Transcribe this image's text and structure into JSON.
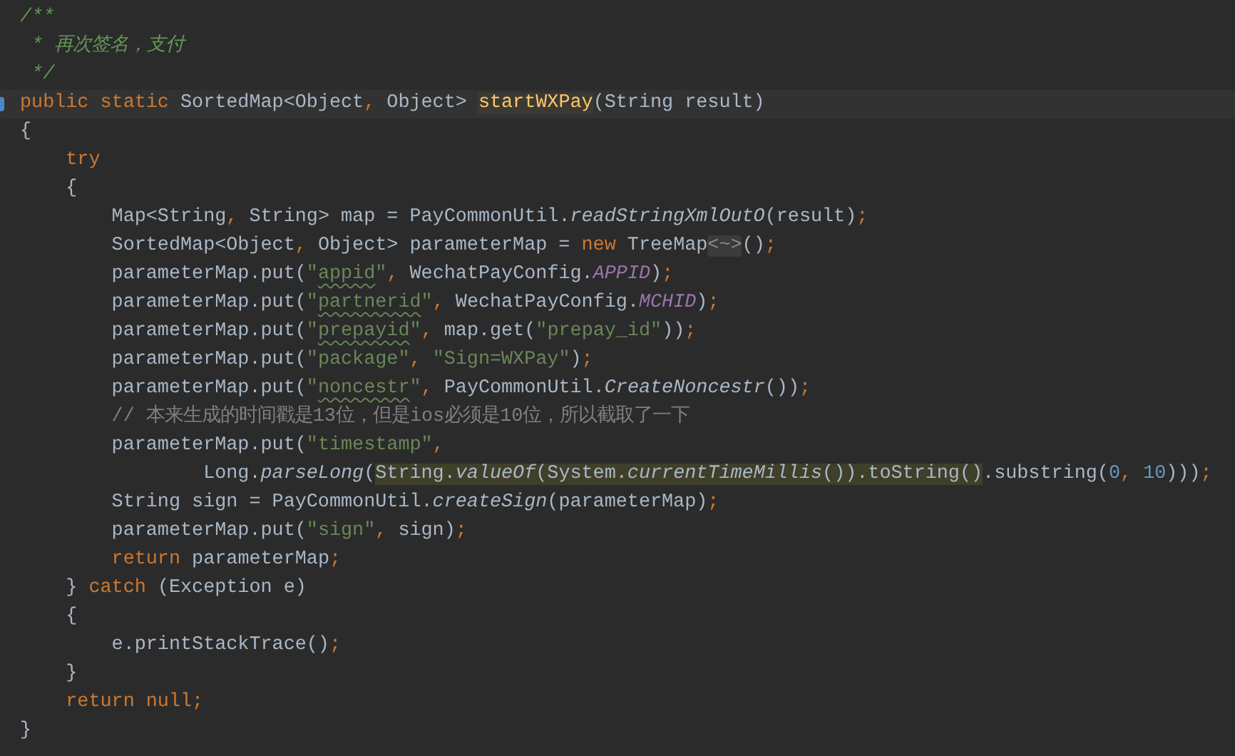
{
  "editor": {
    "lines": [
      {
        "current": false,
        "tokens": [
          {
            "text": "/**",
            "kind": "doc"
          }
        ]
      },
      {
        "current": false,
        "tokens": [
          {
            "text": " * 再次签名，支付",
            "kind": "doc"
          }
        ]
      },
      {
        "current": false,
        "tokens": [
          {
            "text": " */",
            "kind": "doc"
          }
        ]
      },
      {
        "current": true,
        "tokens": [
          {
            "text": "public static ",
            "kind": "keyword"
          },
          {
            "text": "SortedMap<Object",
            "kind": "plain"
          },
          {
            "text": ", ",
            "kind": "punct"
          },
          {
            "text": "Object> ",
            "kind": "plain"
          },
          {
            "text": "startWXPay",
            "kind": "declaration",
            "highlight": true
          },
          {
            "text": "(String result)",
            "kind": "plain"
          }
        ]
      },
      {
        "current": false,
        "tokens": [
          {
            "text": "{",
            "kind": "plain"
          }
        ]
      },
      {
        "current": false,
        "tokens": [
          {
            "text": "    try",
            "kind": "keyword"
          }
        ]
      },
      {
        "current": false,
        "tokens": [
          {
            "text": "    {",
            "kind": "plain"
          }
        ]
      },
      {
        "current": false,
        "tokens": [
          {
            "text": "        Map<String",
            "kind": "plain"
          },
          {
            "text": ", ",
            "kind": "punct"
          },
          {
            "text": "String> map = PayCommonUtil.",
            "kind": "plain"
          },
          {
            "text": "readStringXmlOutO",
            "kind": "call"
          },
          {
            "text": "(result)",
            "kind": "plain"
          },
          {
            "text": ";",
            "kind": "punct"
          }
        ]
      },
      {
        "current": false,
        "tokens": [
          {
            "text": "        SortedMap<Object",
            "kind": "plain"
          },
          {
            "text": ", ",
            "kind": "punct"
          },
          {
            "text": "Object> parameterMap = ",
            "kind": "plain"
          },
          {
            "text": "new ",
            "kind": "keyword"
          },
          {
            "text": "TreeMap",
            "kind": "plain"
          },
          {
            "text": "<~>",
            "kind": "fold"
          },
          {
            "text": "()",
            "kind": "plain"
          },
          {
            "text": ";",
            "kind": "punct"
          }
        ]
      },
      {
        "current": false,
        "tokens": [
          {
            "text": "        parameterMap.put(",
            "kind": "plain"
          },
          {
            "text": "\"",
            "kind": "string"
          },
          {
            "text": "appid",
            "kind": "string",
            "typo": true
          },
          {
            "text": "\"",
            "kind": "string"
          },
          {
            "text": ", ",
            "kind": "punct"
          },
          {
            "text": "WechatPayConfig.",
            "kind": "plain"
          },
          {
            "text": "APPID",
            "kind": "constant"
          },
          {
            "text": ")",
            "kind": "plain"
          },
          {
            "text": ";",
            "kind": "punct"
          }
        ]
      },
      {
        "current": false,
        "tokens": [
          {
            "text": "        parameterMap.put(",
            "kind": "plain"
          },
          {
            "text": "\"",
            "kind": "string"
          },
          {
            "text": "partnerid",
            "kind": "string",
            "typo": true
          },
          {
            "text": "\"",
            "kind": "string"
          },
          {
            "text": ", ",
            "kind": "punct"
          },
          {
            "text": "WechatPayConfig.",
            "kind": "plain"
          },
          {
            "text": "MCHID",
            "kind": "constant"
          },
          {
            "text": ")",
            "kind": "plain"
          },
          {
            "text": ";",
            "kind": "punct"
          }
        ]
      },
      {
        "current": false,
        "tokens": [
          {
            "text": "        parameterMap.put(",
            "kind": "plain"
          },
          {
            "text": "\"",
            "kind": "string"
          },
          {
            "text": "prepayid",
            "kind": "string",
            "typo": true
          },
          {
            "text": "\"",
            "kind": "string"
          },
          {
            "text": ", ",
            "kind": "punct"
          },
          {
            "text": "map.get(",
            "kind": "plain"
          },
          {
            "text": "\"prepay_id\"",
            "kind": "string"
          },
          {
            "text": "))",
            "kind": "plain"
          },
          {
            "text": ";",
            "kind": "punct"
          }
        ]
      },
      {
        "current": false,
        "tokens": [
          {
            "text": "        parameterMap.put(",
            "kind": "plain"
          },
          {
            "text": "\"package\"",
            "kind": "string"
          },
          {
            "text": ", ",
            "kind": "punct"
          },
          {
            "text": "\"Sign=WXPay\"",
            "kind": "string"
          },
          {
            "text": ")",
            "kind": "plain"
          },
          {
            "text": ";",
            "kind": "punct"
          }
        ]
      },
      {
        "current": false,
        "tokens": [
          {
            "text": "        parameterMap.put(",
            "kind": "plain"
          },
          {
            "text": "\"",
            "kind": "string"
          },
          {
            "text": "noncestr",
            "kind": "string",
            "typo": true
          },
          {
            "text": "\"",
            "kind": "string"
          },
          {
            "text": ", ",
            "kind": "punct"
          },
          {
            "text": "PayCommonUtil.",
            "kind": "plain"
          },
          {
            "text": "CreateNoncestr",
            "kind": "call"
          },
          {
            "text": "())",
            "kind": "plain"
          },
          {
            "text": ";",
            "kind": "punct"
          }
        ]
      },
      {
        "current": false,
        "tokens": [
          {
            "text": "        // 本来生成的时间戳是13位，但是ios必须是10位，所以截取了一下",
            "kind": "comment"
          }
        ]
      },
      {
        "current": false,
        "tokens": [
          {
            "text": "        parameterMap.put(",
            "kind": "plain"
          },
          {
            "text": "\"timestamp\"",
            "kind": "string"
          },
          {
            "text": ",",
            "kind": "punct"
          }
        ]
      },
      {
        "current": false,
        "tokens": [
          {
            "text": "                Long.",
            "kind": "plain"
          },
          {
            "text": "parseLong",
            "kind": "call"
          },
          {
            "text": "(",
            "kind": "plain"
          },
          {
            "text": "String.",
            "kind": "plain",
            "highlight": true
          },
          {
            "text": "valueOf",
            "kind": "call",
            "highlight": true
          },
          {
            "text": "(System.",
            "kind": "plain",
            "highlight": true
          },
          {
            "text": "currentTimeMillis",
            "kind": "call",
            "highlight": true
          },
          {
            "text": "()).toString()",
            "kind": "plain",
            "highlight": true
          },
          {
            "text": ".substring(",
            "kind": "plain"
          },
          {
            "text": "0",
            "kind": "number"
          },
          {
            "text": ", ",
            "kind": "punct"
          },
          {
            "text": "10",
            "kind": "number"
          },
          {
            "text": ")))",
            "kind": "plain"
          },
          {
            "text": ";",
            "kind": "punct"
          }
        ]
      },
      {
        "current": false,
        "tokens": [
          {
            "text": "        String sign = PayCommonUtil.",
            "kind": "plain"
          },
          {
            "text": "createSign",
            "kind": "call"
          },
          {
            "text": "(parameterMap)",
            "kind": "plain"
          },
          {
            "text": ";",
            "kind": "punct"
          }
        ]
      },
      {
        "current": false,
        "tokens": [
          {
            "text": "        parameterMap.put(",
            "kind": "plain"
          },
          {
            "text": "\"sign\"",
            "kind": "string"
          },
          {
            "text": ", ",
            "kind": "punct"
          },
          {
            "text": "sign)",
            "kind": "plain"
          },
          {
            "text": ";",
            "kind": "punct"
          }
        ]
      },
      {
        "current": false,
        "tokens": [
          {
            "text": "        return ",
            "kind": "keyword"
          },
          {
            "text": "parameterMap",
            "kind": "plain"
          },
          {
            "text": ";",
            "kind": "punct"
          }
        ]
      },
      {
        "current": false,
        "tokens": [
          {
            "text": "    } ",
            "kind": "plain"
          },
          {
            "text": "catch ",
            "kind": "keyword"
          },
          {
            "text": "(Exception e)",
            "kind": "plain"
          }
        ]
      },
      {
        "current": false,
        "tokens": [
          {
            "text": "    {",
            "kind": "plain"
          }
        ]
      },
      {
        "current": false,
        "tokens": [
          {
            "text": "        e.printStackTrace()",
            "kind": "plain"
          },
          {
            "text": ";",
            "kind": "punct"
          }
        ]
      },
      {
        "current": false,
        "tokens": [
          {
            "text": "    }",
            "kind": "plain"
          }
        ]
      },
      {
        "current": false,
        "tokens": [
          {
            "text": "    return null",
            "kind": "keyword"
          },
          {
            "text": ";",
            "kind": "punct"
          }
        ]
      },
      {
        "current": false,
        "tokens": [
          {
            "text": "}",
            "kind": "plain"
          }
        ]
      }
    ]
  }
}
